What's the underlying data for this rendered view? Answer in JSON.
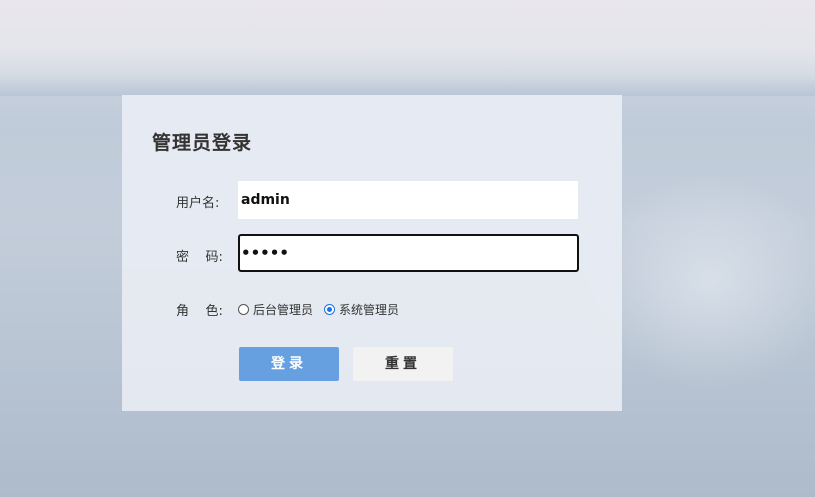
{
  "login": {
    "title": "管理员登录",
    "username_label": "用户名:",
    "username_value": "admin",
    "password_label": "密    码:",
    "password_value": "•••••",
    "role_label": "角    色:",
    "role_options": [
      {
        "label": "后台管理员",
        "checked": false
      },
      {
        "label": "系统管理员",
        "checked": true
      }
    ],
    "login_button": "登录",
    "reset_button": "重置"
  },
  "colors": {
    "primary_button": "#66a0e0",
    "radio_accent": "#1a73e8"
  }
}
